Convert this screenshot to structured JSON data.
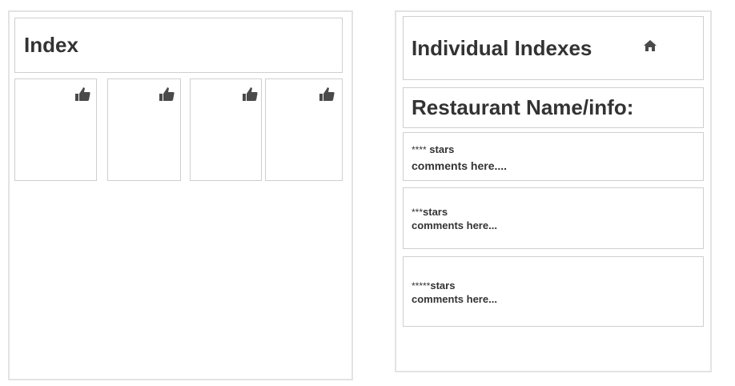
{
  "left_panel": {
    "title": "Index",
    "cards": [
      {
        "icon": "thumbs-up-icon"
      },
      {
        "icon": "thumbs-up-icon"
      },
      {
        "icon": "thumbs-up-icon"
      },
      {
        "icon": "thumbs-up-icon"
      }
    ]
  },
  "right_panel": {
    "title": "Individual Indexes",
    "home_icon": "home-icon",
    "restaurant_heading": "Restaurant Name/info:",
    "reviews": [
      {
        "asterisks": "****",
        "stars_label": " stars",
        "comment": "comments here...."
      },
      {
        "asterisks": "***",
        "stars_label": "stars",
        "comment": "comments here..."
      },
      {
        "asterisks": "*****",
        "stars_label": "stars",
        "comment": "comments here..."
      }
    ]
  },
  "colors": {
    "border_outer": "#e3e3e3",
    "border_inner": "#cfcfcf",
    "text": "#333333",
    "icon": "#4a4a4a"
  }
}
